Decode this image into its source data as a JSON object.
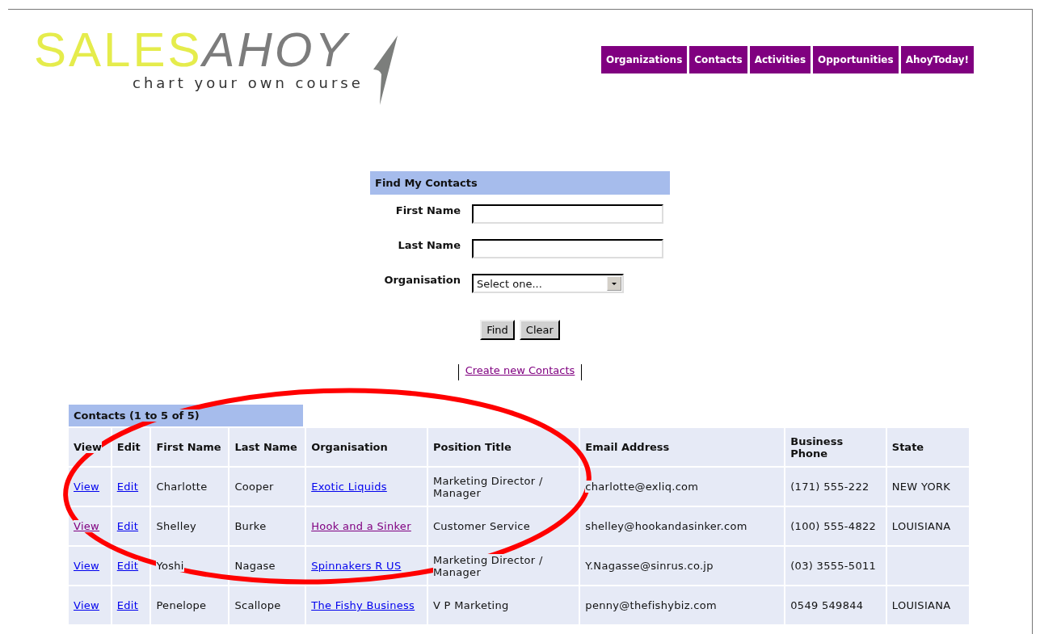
{
  "logo": {
    "brand_first": "SALES",
    "brand_second": "AHOY",
    "tagline": "chart your own course"
  },
  "nav": [
    {
      "label": "Organizations"
    },
    {
      "label": "Contacts"
    },
    {
      "label": "Activities"
    },
    {
      "label": "Opportunities"
    },
    {
      "label": "AhoyToday!"
    }
  ],
  "search": {
    "title": "Find My Contacts",
    "fields": [
      {
        "kind": "text",
        "label": "First Name"
      },
      {
        "kind": "text",
        "label": "Last Name"
      },
      {
        "kind": "select",
        "label": "Organisation",
        "value": "Select one..."
      }
    ],
    "buttons": [
      "Find",
      "Clear"
    ],
    "create_link": {
      "text": "Create new Contacts",
      "visited": true
    }
  },
  "results": {
    "caption": "Contacts (1 to 5 of 5)",
    "columns": [
      "View",
      "Edit",
      "First Name",
      "Last Name",
      "Organisation",
      "Position Title",
      "Email Address",
      "Business Phone",
      "State"
    ],
    "rows": [
      {
        "view": {
          "text": "View",
          "visited": false
        },
        "edit": {
          "text": "Edit",
          "visited": false
        },
        "first_name": "Charlotte",
        "last_name": "Cooper",
        "organisation": {
          "text": "Exotic Liquids",
          "visited": false
        },
        "position": "Marketing Director / Manager",
        "email": "charlotte@exliq.com",
        "phone": "(171) 555-222",
        "state": "NEW YORK"
      },
      {
        "view": {
          "text": "View",
          "visited": true
        },
        "edit": {
          "text": "Edit",
          "visited": false
        },
        "first_name": "Shelley",
        "last_name": "Burke",
        "organisation": {
          "text": "Hook and a Sinker",
          "visited": true
        },
        "position": "Customer Service",
        "email": "shelley@hookandasinker.com",
        "phone": "(100) 555-4822",
        "state": "LOUISIANA"
      },
      {
        "view": {
          "text": "View",
          "visited": false
        },
        "edit": {
          "text": "Edit",
          "visited": false
        },
        "first_name": "Yoshi",
        "last_name": "Nagase",
        "organisation": {
          "text": "Spinnakers R US",
          "visited": false
        },
        "position": "Marketing Director / Manager",
        "email": "Y.Nagasse@sinrus.co.jp",
        "phone": "(03) 3555-5011"
      },
      {
        "view": {
          "text": "View",
          "visited": false
        },
        "edit": {
          "text": "Edit",
          "visited": false
        },
        "first_name": "Penelope",
        "last_name": "Scallope",
        "organisation": {
          "text": "The Fishy Business",
          "visited": false
        },
        "position": "V P Marketing",
        "email": "penny@thefishybiz.com",
        "phone": "0549 549844",
        "state": "LOUISIANA"
      }
    ]
  }
}
